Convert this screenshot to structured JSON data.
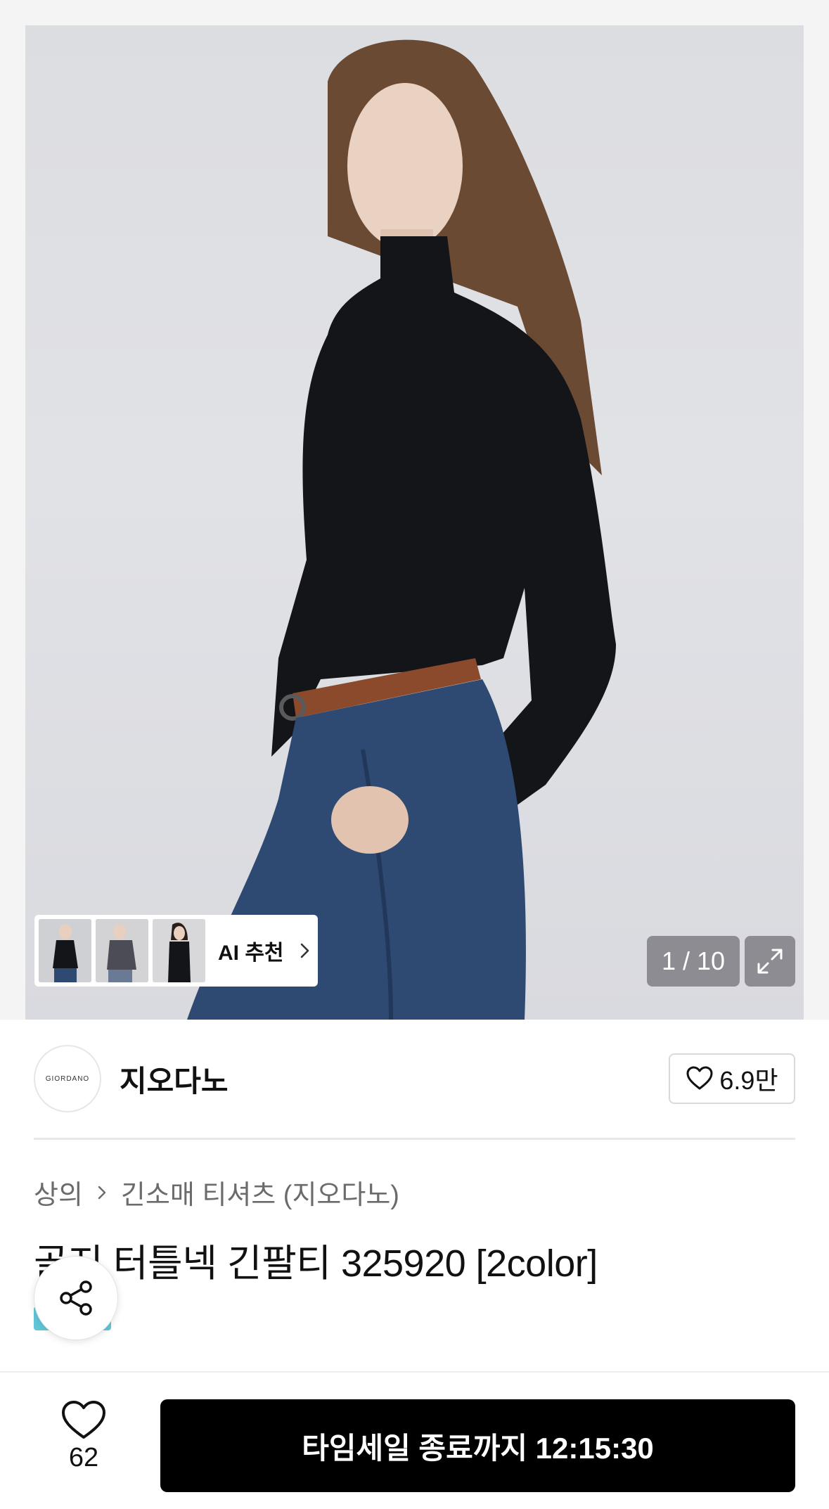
{
  "gallery": {
    "ai_label": "AI 추천",
    "pager": "1 / 10"
  },
  "brand": {
    "logo_text": "GIORDANO",
    "name": "지오다노",
    "likes": "6.9만"
  },
  "breadcrumb": {
    "level1": "상의",
    "level2": "긴소매 티셔츠 (지오다노)"
  },
  "product": {
    "title": "골지 터틀넥 긴팔티 325920 [2color]"
  },
  "bottom_bar": {
    "wish_count": "62",
    "cta_label": "타임세일 종료까지 12:15:30"
  },
  "colors": {
    "accent": "#000000",
    "tag": "#62c6d9"
  }
}
